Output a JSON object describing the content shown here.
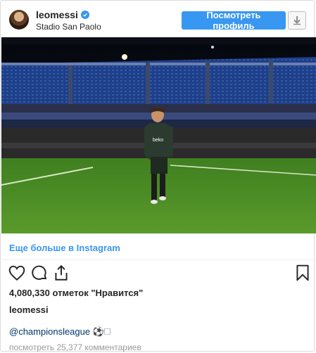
{
  "header": {
    "username": "leomessi",
    "location": "Stadio San Paolo",
    "profile_button": "Посмотреть профиль"
  },
  "photo": {
    "description_icon": "stadium-photo",
    "jersey_text": "beko"
  },
  "more_link": "Еще больше в Instagram",
  "actions": {
    "like_icon": "heart-icon",
    "comment_icon": "comment-icon",
    "share_icon": "share-icon",
    "save_icon": "bookmark-icon"
  },
  "likes_text": "4,080,330 отметок \"Нравится\"",
  "caption": {
    "username": "leomessi",
    "tags": "@championsleague ⚽️🗆"
  },
  "comments_text": "посмотреть 25,377 комментариев",
  "colors": {
    "accent": "#3897f0",
    "link_dark": "#003569",
    "muted": "#999999"
  }
}
